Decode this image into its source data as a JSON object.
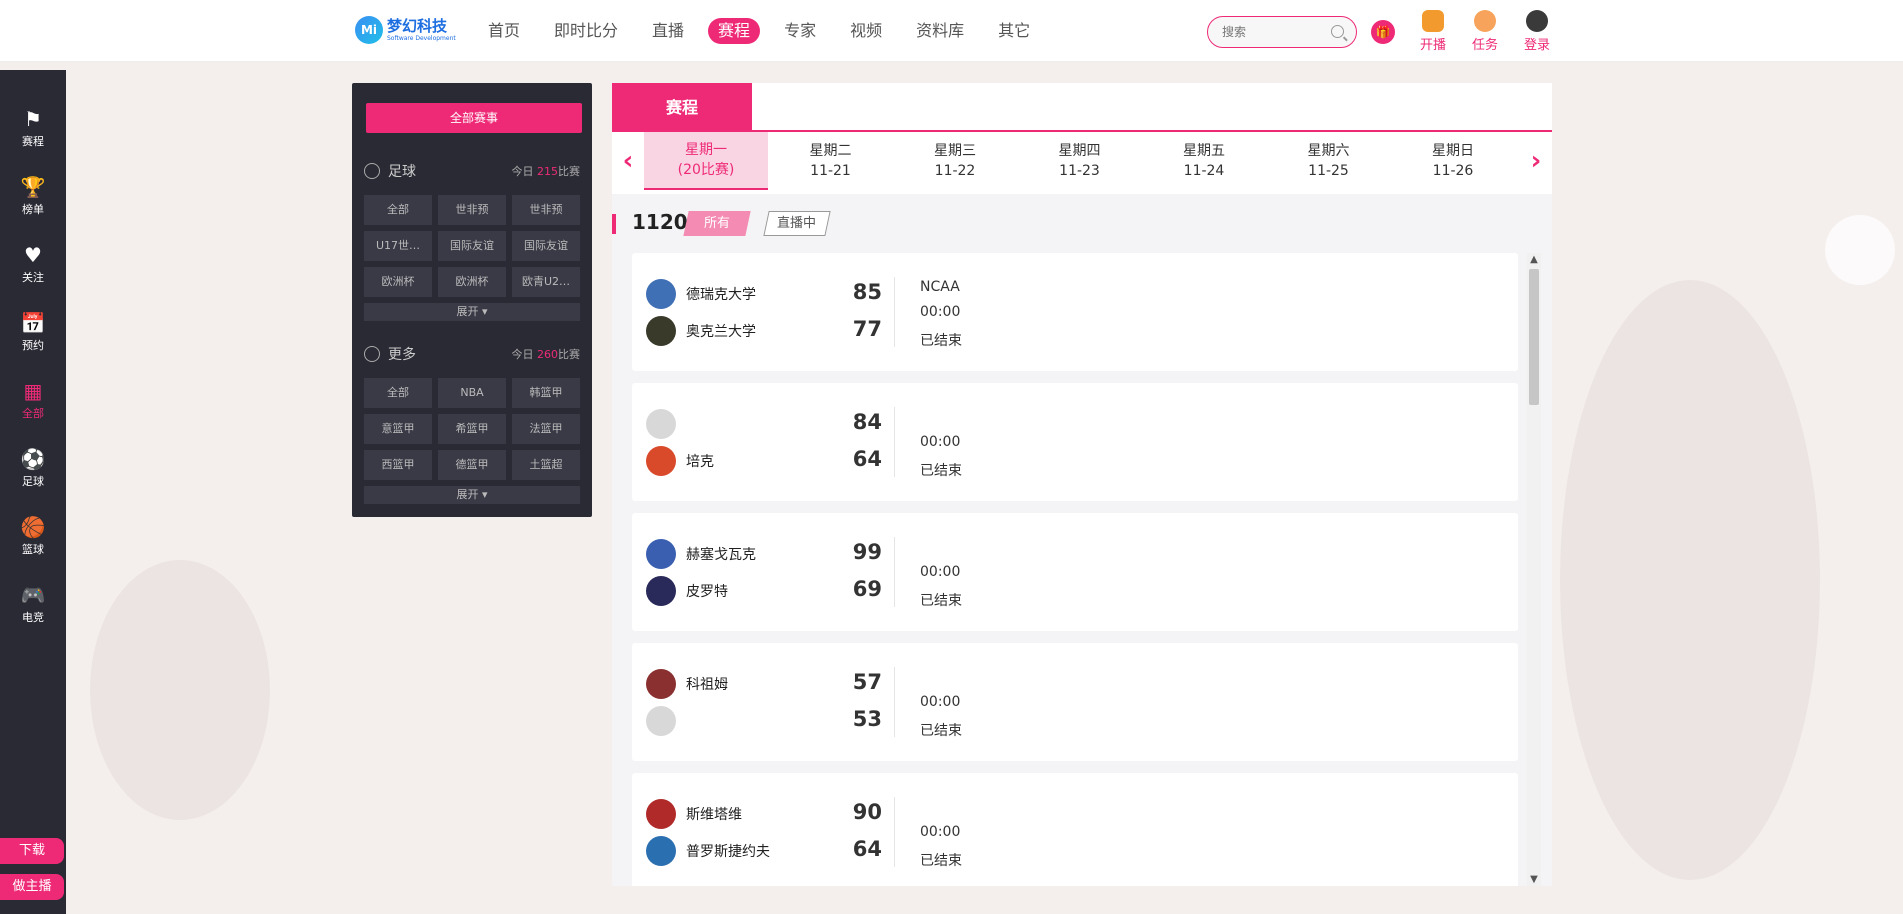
{
  "header": {
    "logo_mark": "Mi",
    "logo_main": "梦幻科技",
    "logo_sub": "Software Development",
    "nav": [
      "首页",
      "即时比分",
      "直播",
      "赛程",
      "专家",
      "视频",
      "资料库",
      "其它"
    ],
    "nav_active_index": 3,
    "search_placeholder": "搜索",
    "actions": [
      "开播",
      "任务",
      "登录"
    ]
  },
  "sidebar": {
    "items": [
      {
        "label": "赛程",
        "icon": "flag-icon"
      },
      {
        "label": "榜单",
        "icon": "trophy-icon"
      },
      {
        "label": "关注",
        "icon": "heart-icon"
      },
      {
        "label": "预约",
        "icon": "calendar-icon"
      },
      {
        "label": "全部",
        "icon": "grid-icon"
      },
      {
        "label": "足球",
        "icon": "soccer-ball-icon"
      },
      {
        "label": "篮球",
        "icon": "basketball-icon"
      },
      {
        "label": "电竞",
        "icon": "gamepad-icon"
      }
    ],
    "active_index": 4,
    "bottom_buttons": [
      "下载",
      "做主播"
    ]
  },
  "filter": {
    "all_label": "全部赛事",
    "sections": [
      {
        "title": "足球",
        "count_prefix": "今日",
        "count": "215",
        "count_suffix": "比赛",
        "chips": [
          "全部",
          "世非预",
          "世非预",
          "U17世…",
          "国际友谊",
          "国际友谊",
          "欧洲杯",
          "欧洲杯",
          "欧青U2…"
        ],
        "expand": "展开 ▾"
      },
      {
        "title": "更多",
        "count_prefix": "今日",
        "count": "260",
        "count_suffix": "比赛",
        "chips": [
          "全部",
          "NBA",
          "韩篮甲",
          "意篮甲",
          "希篮甲",
          "法篮甲",
          "西篮甲",
          "德篮甲",
          "土篮超"
        ],
        "expand": "展开 ▾"
      }
    ]
  },
  "schedule": {
    "tab_label": "赛程",
    "days": [
      {
        "name": "星期一",
        "sub": "(20比赛)"
      },
      {
        "name": "星期二",
        "sub": "11-21"
      },
      {
        "name": "星期三",
        "sub": "11-22"
      },
      {
        "name": "星期四",
        "sub": "11-23"
      },
      {
        "name": "星期五",
        "sub": "11-24"
      },
      {
        "name": "星期六",
        "sub": "11-25"
      },
      {
        "name": "星期日",
        "sub": "11-26"
      }
    ],
    "active_day": 0,
    "date": "1120",
    "pill_all": "所有",
    "pill_live": "直播中",
    "matches": [
      {
        "home": "德瑞克大学",
        "home_score": "85",
        "away": "奥克兰大学",
        "away_score": "77",
        "league": "NCAA",
        "time": "00:00",
        "status": "已结束",
        "home_color": "#3f6fb5",
        "away_color": "#3a3a2a"
      },
      {
        "home": "",
        "home_score": "84",
        "away": "培克",
        "away_score": "64",
        "league": "",
        "time": "00:00",
        "status": "已结束",
        "home_color": "#d8d8d8",
        "away_color": "#d94a2a"
      },
      {
        "home": "赫塞戈瓦克",
        "home_score": "99",
        "away": "皮罗特",
        "away_score": "69",
        "league": "",
        "time": "00:00",
        "status": "已结束",
        "home_color": "#3a5fb0",
        "away_color": "#2a2a5a"
      },
      {
        "home": "科祖姆",
        "home_score": "57",
        "away": "",
        "away_score": "53",
        "league": "",
        "time": "00:00",
        "status": "已结束",
        "home_color": "#8a3030",
        "away_color": "#d8d8d8"
      },
      {
        "home": "斯维塔维",
        "home_score": "90",
        "away": "普罗斯捷约夫",
        "away_score": "64",
        "league": "",
        "time": "00:00",
        "status": "已结束",
        "home_color": "#b02a2a",
        "away_color": "#2a6fb0"
      }
    ]
  },
  "colors": {
    "accent": "#ee2a76",
    "dark": "#2a2a35"
  }
}
